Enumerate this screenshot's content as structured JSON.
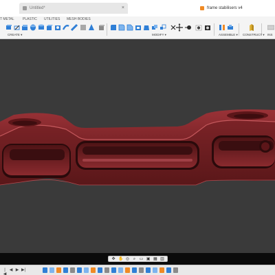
{
  "titlebar": {
    "tab_inactive": "Untitled*",
    "tab_active": "frame stabilisers v4",
    "close_glyph": "×"
  },
  "toolbar": {
    "workspace_tabs": [
      "T METAL",
      "PLASTIC",
      "UTILITIES",
      "MESH BODIES"
    ],
    "groups": {
      "create": "CREATE ▾",
      "modify": "MODIFY ▾",
      "assemble": "ASSEMBLE ▾",
      "construct": "CONSTRUCT ▾",
      "insp": "INS"
    },
    "colors": {
      "accent": "#1c5fbf",
      "icon_blue": "#2f7fd6",
      "icon_dark": "#2b2b2b"
    }
  },
  "viewport": {
    "background": "#3a3a3a",
    "model_color": "#7f2427",
    "model_shadow": "#4f1416"
  },
  "navbar": {
    "items": [
      "orbit-icon",
      "pan-icon",
      "look-at-icon",
      "zoom-icon",
      "fit-icon",
      "display-settings-icon",
      "grid-icon",
      "viewports-icon"
    ]
  },
  "timeline": {
    "controls": [
      "|◀",
      "◀",
      "▶",
      "▶|"
    ],
    "item_count": 20
  }
}
